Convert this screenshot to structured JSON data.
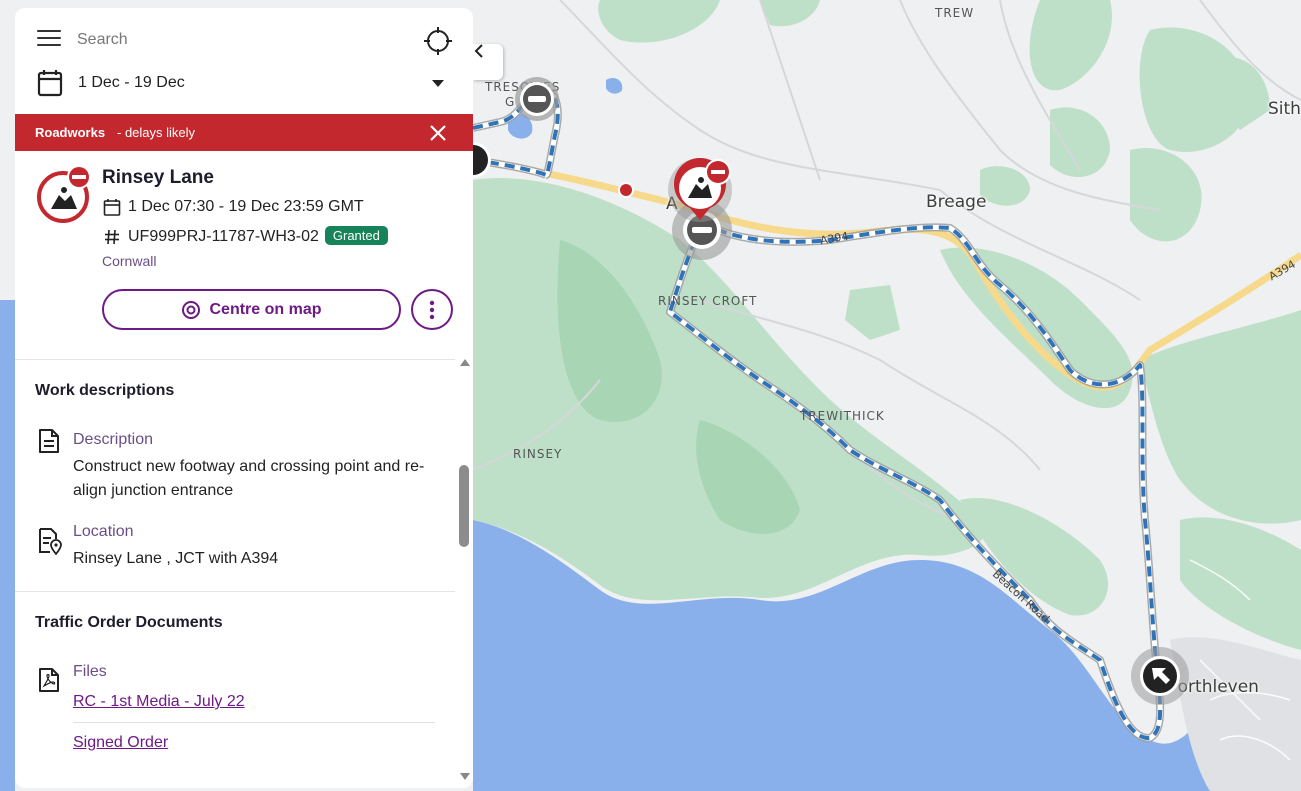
{
  "search": {
    "placeholder": "Search"
  },
  "date_range": {
    "label": "1 Dec - 19 Dec"
  },
  "alert": {
    "title": "Roadworks",
    "subtitle": "- delays likely"
  },
  "detail": {
    "title": "Rinsey Lane",
    "datetime": "1 Dec 07:30 - 19 Dec 23:59 GMT",
    "reference": "UF999PRJ-11787-WH3-02",
    "status": "Granted",
    "region": "Cornwall",
    "centre_button": "Centre on map"
  },
  "work_descriptions": {
    "title": "Work descriptions",
    "description_label": "Description",
    "description_value": "Construct new footway and crossing point and re-align junction entrance",
    "location_label": "Location",
    "location_value": "Rinsey Lane , JCT with A394"
  },
  "traffic_order": {
    "title": "Traffic Order Documents",
    "files_label": "Files",
    "files": [
      "RC - 1st Media - July 22",
      "Signed Order"
    ]
  },
  "map_labels": {
    "trew": "TREW",
    "tresowes": "TRESOWES",
    "tresowes_sub": "G",
    "a_label": "A",
    "breage": "Breage",
    "sithney": "Sith",
    "rinsey_croft": "RINSEY CROFT",
    "trewithick": "TREWITHICK",
    "rinsey": "RINSEY",
    "a394_1": "A394",
    "a394_2": "A394",
    "beacon_road": "Beacon Road",
    "porthleven": "Porthleven"
  },
  "colors": {
    "alert_red": "#c4282f",
    "brand_purple": "#6e1a86",
    "granted_green": "#17835b",
    "route_blue": "#2f73b8"
  },
  "icons": {
    "menu": "menu-icon",
    "locate": "crosshair-icon",
    "calendar": "calendar-icon",
    "close": "close-icon",
    "roadworks": "roadworks-icon",
    "hash": "hash-icon",
    "target": "target-icon",
    "more": "more-vertical-icon",
    "document": "document-icon",
    "location_doc": "location-document-icon",
    "pdf": "pdf-icon"
  }
}
